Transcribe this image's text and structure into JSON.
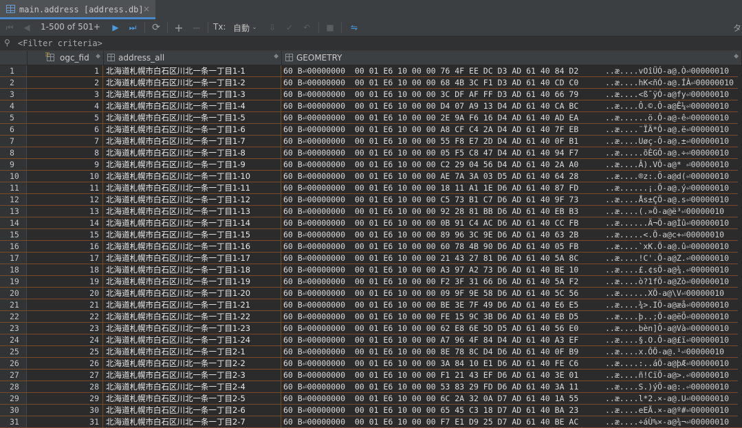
{
  "tab": {
    "title": "main.address [address.db]",
    "close": "×"
  },
  "toolbar": {
    "paging": "1-500 of 501+",
    "tx_label": "Tx:",
    "tx_value": "自動",
    "right_glyph": "タ"
  },
  "filter": {
    "text": "<Filter criteria>"
  },
  "columns": [
    {
      "name": "ogc_fid"
    },
    {
      "name": "address_all"
    },
    {
      "name": "GEOMETRY"
    }
  ],
  "rows": [
    {
      "n": "1",
      "fid": "1",
      "addr": "北海道札幌市白石区川北一条一丁目1-1",
      "hex": "60 B⏎00000000  00 01 E6 10 00 00 76 4F EE DC D3 AD 61 40 84 D2",
      "ascii": "..æ....vOîÜÓ-a@.Ò⏎00000010"
    },
    {
      "n": "2",
      "fid": "2",
      "addr": "北海道札幌市白石区川北一条一丁目1-2",
      "hex": "60 B⏎00000000  00 01 E6 10 00 00 68 4B 3C F1 D3 AD 61 40 CD C0",
      "ascii": "..æ....hK<ñÓ-a@.ÍÀ⏎00000010"
    },
    {
      "n": "3",
      "fid": "3",
      "addr": "北海道札幌市白石区川北一条一丁目1-3",
      "hex": "60 B⏎00000000  00 01 E6 10 00 00 3C DF AF FF D3 AD 61 40 66 79",
      "ascii": "..æ....<ß¯ÿÓ-a@fy⏎00000010"
    },
    {
      "n": "4",
      "fid": "4",
      "addr": "北海道札幌市白石区川北一条一丁目1-4",
      "hex": "60 B⏎00000000  00 01 E6 10 00 00 D4 07 A9 13 D4 AD 61 40 CA BC",
      "ascii": "..æ....Ô.©.Ô-a@Ê¼⏎00000010"
    },
    {
      "n": "5",
      "fid": "5",
      "addr": "北海道札幌市白石区川北一条一丁目1-5",
      "hex": "60 B⏎00000000  00 01 E6 10 00 00 2E 9A F6 16 D4 AD 61 40 AD EA",
      "ascii": "..æ......ö.Ô-a@-ê⏎00000010"
    },
    {
      "n": "6",
      "fid": "6",
      "addr": "北海道札幌市白石区川北一条一丁目1-6",
      "hex": "60 B⏎00000000  00 01 E6 10 00 00 A8 CF C4 2A D4 AD 61 40 7F EB",
      "ascii": "..æ....¨ÏÄ*Ô-a@.ë⏎00000010"
    },
    {
      "n": "7",
      "fid": "7",
      "addr": "北海道札幌市白石区川北一条一丁目1-7",
      "hex": "60 B⏎00000000  00 01 E6 10 00 00 55 F8 E7 2D D4 AD 61 40 0F B1",
      "ascii": "..æ....Uøç-Ô-a@.±⏎00000010"
    },
    {
      "n": "8",
      "fid": "8",
      "addr": "北海道札幌市白石区川北一条一丁目1-8",
      "hex": "60 B⏎00000000  00 01 E6 10 00 00 05 F5 C8 47 D4 AD 61 40 94 F7",
      "ascii": "..æ.....õÈGÔ-a@.÷⏎00000010"
    },
    {
      "n": "9",
      "fid": "9",
      "addr": "北海道札幌市白石区川北一条一丁目1-9",
      "hex": "60 B⏎00000000  00 01 E6 10 00 00 C2 29 04 56 D4 AD 61 40 2A A0",
      "ascii": "..æ....Â).VÔ-a@* ⏎00000010"
    },
    {
      "n": "10",
      "fid": "10",
      "addr": "北海道札幌市白石区川北一条一丁目1-10",
      "hex": "60 B⏎00000000  00 01 E6 10 00 00 AE 7A 3A 03 D5 AD 61 40 64 28",
      "ascii": "..æ....®z:.Õ-a@d(⏎00000010"
    },
    {
      "n": "11",
      "fid": "11",
      "addr": "北海道札幌市白石区川北一条一丁目1-11",
      "hex": "60 B⏎00000000  00 01 E6 10 00 00 18 11 A1 1E D6 AD 61 40 87 FD",
      "ascii": "..æ......¡.Ö-a@.ý⏎00000010"
    },
    {
      "n": "12",
      "fid": "12",
      "addr": "北海道札幌市白石区川北一条一丁目1-12",
      "hex": "60 B⏎00000000  00 01 E6 10 00 00 C5 73 B1 C7 D6 AD 61 40 9F 73",
      "ascii": "..æ....Ås±ÇÖ-a@.s⏎00000010"
    },
    {
      "n": "13",
      "fid": "13",
      "addr": "北海道札幌市白石区川北一条一丁目1-13",
      "hex": "60 B⏎00000000  00 01 E6 10 00 00 92 28 81 BB D6 AD 61 40 EB B3",
      "ascii": "..æ....(.»Ö-a@ë³⏎00000010"
    },
    {
      "n": "14",
      "fid": "14",
      "addr": "北海道札幌市白石区川北一条一丁目1-14",
      "hex": "60 B⏎00000000  00 01 E6 10 00 00 0B 91 C4 AC D6 AD 61 40 CC FB",
      "ascii": "..æ......Ä¬Ö-a@Ìû⏎00000010"
    },
    {
      "n": "15",
      "fid": "15",
      "addr": "北海道札幌市白石区川北一条一丁目1-15",
      "hex": "60 B⏎00000000  00 01 E6 10 00 00 89 96 3C 9E D6 AD 61 40 63 2B",
      "ascii": "..æ.....<.Ö-a@c+⏎00000010"
    },
    {
      "n": "16",
      "fid": "16",
      "addr": "北海道札幌市白石区川北一条一丁目1-16",
      "hex": "60 B⏎00000000  00 01 E6 10 00 00 60 78 4B 90 D6 AD 61 40 05 FB",
      "ascii": "..æ....`xK.Ö-a@.û⏎00000010"
    },
    {
      "n": "17",
      "fid": "17",
      "addr": "北海道札幌市白石区川北一条一丁目1-17",
      "hex": "60 B⏎00000000  00 01 E6 10 00 00 21 43 27 81 D6 AD 61 40 5A 8C",
      "ascii": "..æ....!C'.Ö-a@Z.⏎00000010"
    },
    {
      "n": "18",
      "fid": "18",
      "addr": "北海道札幌市白石区川北一条一丁目1-18",
      "hex": "60 B⏎00000000  00 01 E6 10 00 00 A3 97 A2 73 D6 AD 61 40 BE 10",
      "ascii": "..æ....£.¢sÖ-a@¾.⏎00000010"
    },
    {
      "n": "19",
      "fid": "19",
      "addr": "北海道札幌市白石区川北一条一丁目1-19",
      "hex": "60 B⏎00000000  00 01 E6 10 00 00 F2 3F 31 66 D6 AD 61 40 5A F2",
      "ascii": "..æ....ò?1fÖ-a@Zò⏎00000010"
    },
    {
      "n": "20",
      "fid": "20",
      "addr": "北海道札幌市白石区川北一条一丁目1-20",
      "hex": "60 B⏎00000000  00 01 E6 10 00 00 09 9F 9E 58 D6 AD 61 40 5C 56",
      "ascii": "..æ......XÖ-a@\\V⏎00000010"
    },
    {
      "n": "21",
      "fid": "21",
      "addr": "北海道札幌市白石区川北一条一丁目1-21",
      "hex": "60 B⏎00000000  00 01 E6 10 00 00 BE 3E 7F 49 D6 AD 61 40 E6 E5",
      "ascii": "..æ....¾>.IÖ-a@æå⏎00000010"
    },
    {
      "n": "22",
      "fid": "22",
      "addr": "北海道札幌市白石区川北一条一丁目1-22",
      "hex": "60 B⏎00000000  00 01 E6 10 00 00 FE 15 9C 3B D6 AD 61 40 EB D5",
      "ascii": "..æ....þ..;Ö-a@ëÕ⏎00000010"
    },
    {
      "n": "23",
      "fid": "23",
      "addr": "北海道札幌市白石区川北一条一丁目1-23",
      "hex": "60 B⏎00000000  00 01 E6 10 00 00 62 E8 6E 5D D5 AD 61 40 56 E0",
      "ascii": "..æ....bèn]Õ-a@Và⏎00000010"
    },
    {
      "n": "24",
      "fid": "24",
      "addr": "北海道札幌市白石区川北一条一丁目1-24",
      "hex": "60 B⏎00000000  00 01 E6 10 00 00 A7 96 4F 84 D4 AD 61 40 A3 EF",
      "ascii": "..æ....§.O.Ô-a@£ï⏎00000010"
    },
    {
      "n": "25",
      "fid": "25",
      "addr": "北海道札幌市白石区川北一条一丁目2-1",
      "hex": "60 B⏎00000000  00 01 E6 10 00 00 8E 78 8C D4 D6 AD 61 40 0F B9",
      "ascii": "..æ....x.ÔÖ-a@.¹⏎00000010"
    },
    {
      "n": "26",
      "fid": "26",
      "addr": "北海道札幌市白石区川北一条一丁目2-2",
      "hex": "60 B⏎00000000  00 01 E6 10 00 00 3A 84 10 E1 D6 AD 61 40 FE C6",
      "ascii": "..æ....:..áÖ-a@þÆ⏎00000010"
    },
    {
      "n": "27",
      "fid": "27",
      "addr": "北海道札幌市白石区川北一条一丁目2-3",
      "hex": "60 B⏎00000000  00 01 E6 10 00 00 F1 21 43 EF D6 AD 61 40 3E 01",
      "ascii": "..æ....ñ!CïÖ-a@>.⏎00000010"
    },
    {
      "n": "28",
      "fid": "28",
      "addr": "北海道札幌市白石区川北一条一丁目2-4",
      "hex": "60 B⏎00000000  00 01 E6 10 00 00 53 83 29 FD D6 AD 61 40 3A 11",
      "ascii": "..æ....S.)ýÖ-a@:.⏎00000010"
    },
    {
      "n": "29",
      "fid": "29",
      "addr": "北海道札幌市白石区川北一条一丁目2-5",
      "hex": "60 B⏎00000000  00 01 E6 10 00 00 6C 2A 32 0A D7 AD 61 40 1A 55",
      "ascii": "..æ....l*2.×-a@.U⏎00000010"
    },
    {
      "n": "30",
      "fid": "30",
      "addr": "北海道札幌市白石区川北一条一丁目2-6",
      "hex": "60 B⏎00000000  00 01 E6 10 00 00 65 45 C3 18 D7 AD 61 40 BA 23",
      "ascii": "..æ....eEÃ.×-a@º#⏎00000010"
    },
    {
      "n": "31",
      "fid": "31",
      "addr": "北海道札幌市白石区川北一条一丁目2-7",
      "hex": "60 B⏎00000000  00 01 E6 10 00 00 F7 E1 D9 25 D7 AD 61 40 BE AC",
      "ascii": "..æ....÷áÙ%×-a@¾¬⏎00000010"
    }
  ]
}
